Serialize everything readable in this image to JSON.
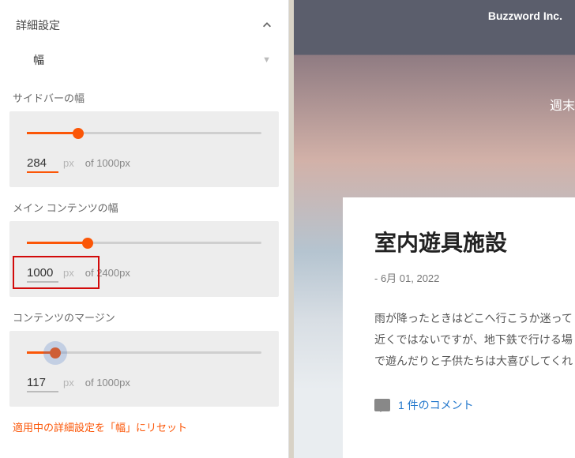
{
  "panel": {
    "title": "詳細設定",
    "dropdown_label": "幅",
    "reset_text": "適用中の詳細設定を「幅」にリセット"
  },
  "controls": {
    "sidebar_width": {
      "label": "サイドバーの幅",
      "value": "284",
      "unit": "px",
      "of_text": "of 1000px",
      "max": 1000,
      "fill_pct": 22
    },
    "main_width": {
      "label": "メイン コンテンツの幅",
      "value": "1000",
      "unit": "px",
      "of_text": "of 2400px",
      "max": 2400,
      "fill_pct": 26
    },
    "margin": {
      "label": "コンテンツのマージン",
      "value": "117",
      "unit": "px",
      "of_text": "of 1000px",
      "max": 1000,
      "fill_pct": 12
    }
  },
  "preview": {
    "brand": "Buzzword Inc.",
    "side_text": "週末",
    "post": {
      "title": "室内遊具施設",
      "date": "- 6月 01, 2022",
      "body": [
        "雨が降ったときはどこへ行こうか迷って",
        "近くではないですが、地下鉄で行ける場",
        "で遊んだりと子供たちは大喜びしてくれ"
      ],
      "comment_text": "1 件のコメント"
    }
  }
}
